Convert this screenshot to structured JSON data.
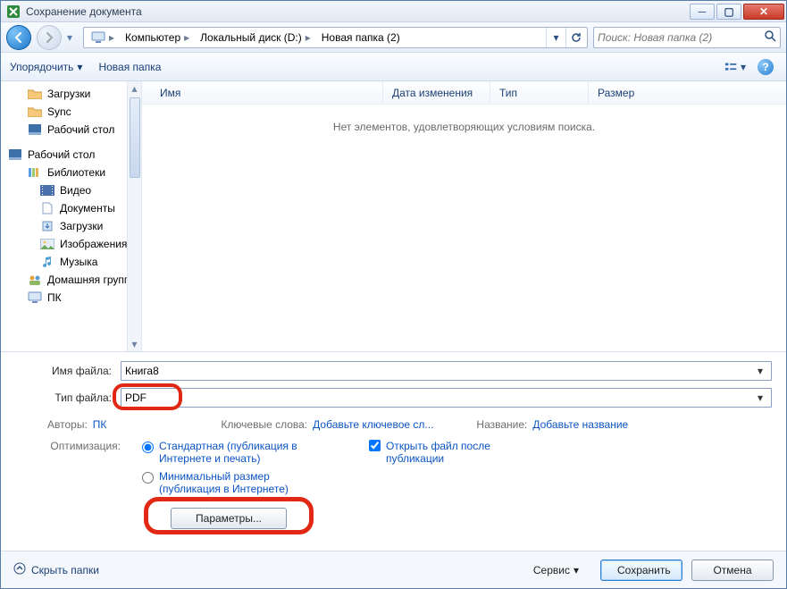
{
  "titlebar": {
    "title": "Сохранение документа",
    "ghost": ""
  },
  "nav": {
    "breadcrumb": [
      "Компьютер",
      "Локальный диск (D:)",
      "Новая папка (2)"
    ],
    "search_placeholder": "Поиск: Новая папка (2)"
  },
  "toolbar": {
    "organize": "Упорядочить",
    "new_folder": "Новая папка"
  },
  "sidebar": {
    "quick": [
      {
        "label": "Загрузки"
      },
      {
        "label": "Sync"
      },
      {
        "label": "Рабочий стол"
      }
    ],
    "desktop_root": "Рабочий стол",
    "libraries": "Библиотеки",
    "lib_items": [
      {
        "label": "Видео"
      },
      {
        "label": "Документы"
      },
      {
        "label": "Загрузки"
      },
      {
        "label": "Изображения"
      },
      {
        "label": "Музыка"
      }
    ],
    "homegroup": "Домашняя групп",
    "pc": "ПК"
  },
  "columns": {
    "name": "Имя",
    "date": "Дата изменения",
    "type": "Тип",
    "size": "Размер"
  },
  "empty_message": "Нет элементов, удовлетворяющих условиям поиска.",
  "form": {
    "filename_label": "Имя файла:",
    "filename_value": "Книга8",
    "filetype_label": "Тип файла:",
    "filetype_value": "PDF",
    "authors_label": "Авторы:",
    "authors_value": "ПК",
    "keywords_label": "Ключевые слова:",
    "keywords_value": "Добавьте ключевое сл...",
    "title_label": "Название:",
    "title_value": "Добавьте название",
    "optimize_label": "Оптимизация:",
    "opt_standard": "Стандартная (публикация в Интернете и печать)",
    "opt_min": "Минимальный размер (публикация в Интернете)",
    "open_after": "Открыть файл после публикации",
    "options_btn": "Параметры..."
  },
  "footer": {
    "hide_folders": "Скрыть папки",
    "tools": "Сервис",
    "save": "Сохранить",
    "cancel": "Отмена"
  }
}
